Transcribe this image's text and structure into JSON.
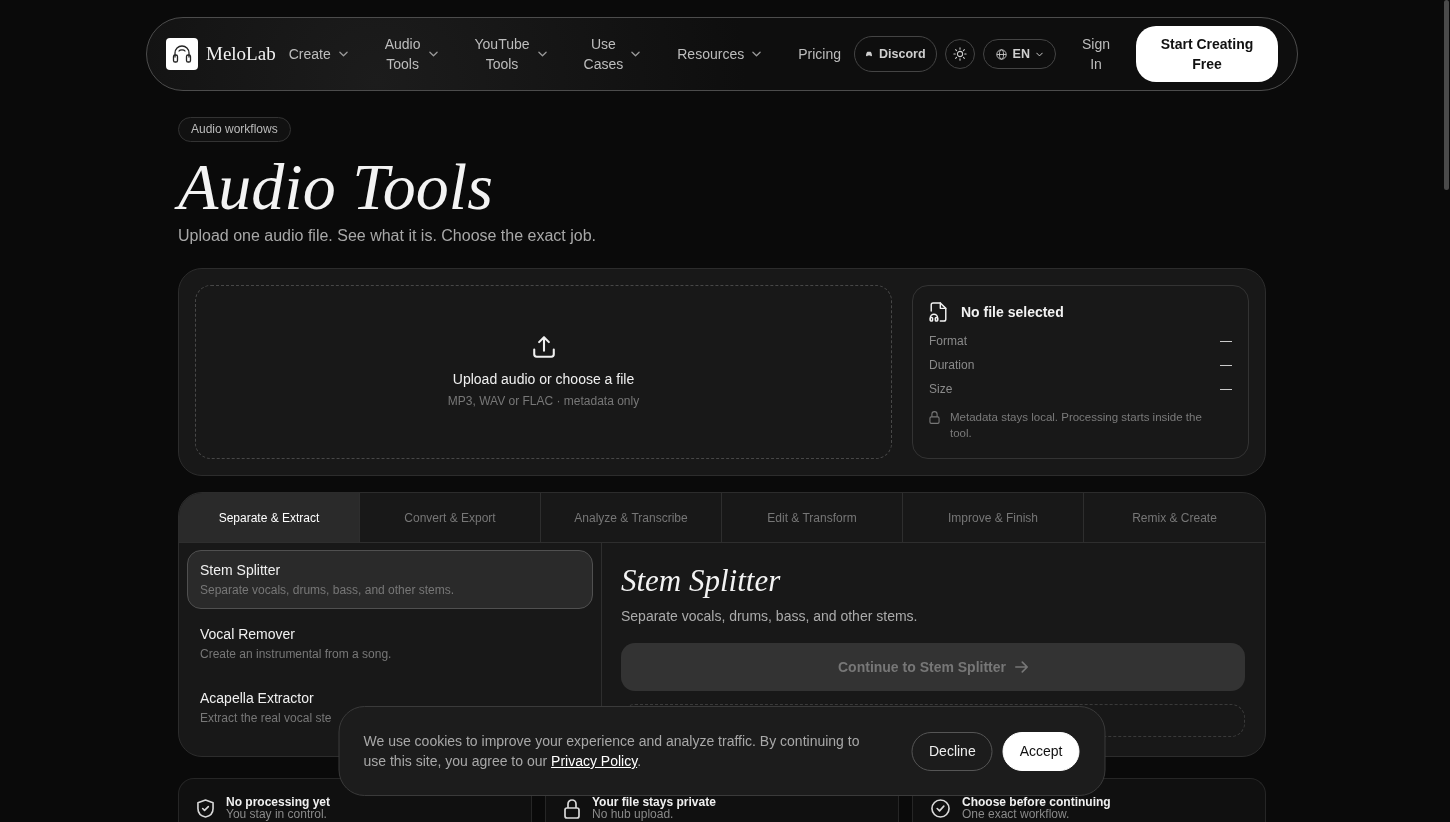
{
  "nav": {
    "brand": "MeloLab",
    "links": [
      {
        "label": "Create",
        "dropdown": true
      },
      {
        "label": "Audio Tools",
        "dropdown": true
      },
      {
        "label": "YouTube Tools",
        "dropdown": true
      },
      {
        "label": "Use Cases",
        "dropdown": true
      },
      {
        "label": "Resources",
        "dropdown": true
      },
      {
        "label": "Pricing",
        "dropdown": false
      }
    ],
    "discord": "Discord",
    "language": "EN",
    "sign_in": "Sign In",
    "cta": "Start Creating Free"
  },
  "tag": "Audio workflows",
  "title": "Audio Tools",
  "subtitle": "Upload one audio file. See what it is. Choose the exact job.",
  "upload": {
    "title": "Upload audio or choose a file",
    "hint": "MP3, WAV or FLAC · metadata only"
  },
  "file_info": {
    "title": "No file selected",
    "rows": [
      {
        "label": "Format",
        "value": "—"
      },
      {
        "label": "Duration",
        "value": "—"
      },
      {
        "label": "Size",
        "value": "—"
      }
    ],
    "note": "Metadata stays local. Processing starts inside the tool."
  },
  "tabs": [
    {
      "label": "Separate & Extract",
      "selected": true
    },
    {
      "label": "Convert & Export",
      "selected": false
    },
    {
      "label": "Analyze & Transcribe",
      "selected": false
    },
    {
      "label": "Edit & Transform",
      "selected": false
    },
    {
      "label": "Improve & Finish",
      "selected": false
    },
    {
      "label": "Remix & Create",
      "selected": false
    }
  ],
  "tools": [
    {
      "name": "Stem Splitter",
      "description": "Separate vocals, drums, bass, and other stems.",
      "selected": true
    },
    {
      "name": "Vocal Remover",
      "description": "Create an instrumental from a song.",
      "selected": false
    },
    {
      "name": "Acapella Extractor",
      "description": "Extract the real vocal ste",
      "selected": false
    }
  ],
  "detail": {
    "title": "Stem Splitter",
    "description": "Separate vocals, drums, bass, and other stems.",
    "button": {
      "label": "Continue to Stem Splitter",
      "disabled": true
    }
  },
  "features": [
    {
      "title": "No processing yet",
      "subtitle": "You stay in control."
    },
    {
      "title": "Your file stays private",
      "subtitle": "No hub upload."
    },
    {
      "title": "Choose before continuing",
      "subtitle": "One exact workflow."
    }
  ],
  "cookie": {
    "text": "We use cookies to improve your experience and analyze traffic. By continuing to use this site, you agree to our ",
    "link": "Privacy Policy",
    "after": ".",
    "buttons": [
      {
        "label": "Decline",
        "kind": "secondary"
      },
      {
        "label": "Accept",
        "kind": "primary"
      }
    ]
  }
}
